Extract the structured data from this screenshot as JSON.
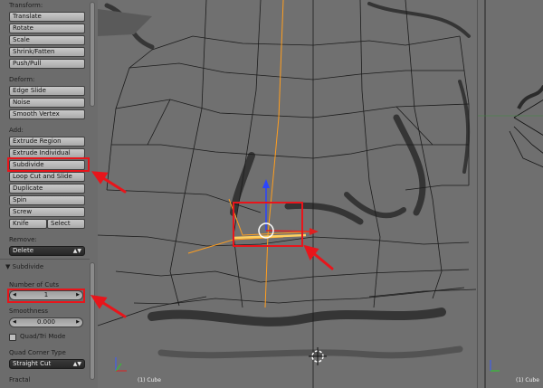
{
  "toolshelf": {
    "transform_title": "Transform:",
    "transform_buttons": [
      "Translate",
      "Rotate",
      "Scale",
      "Shrink/Fatten",
      "Push/Pull"
    ],
    "deform_title": "Deform:",
    "deform_buttons": [
      "Edge Slide",
      "Noise",
      "Smooth Vertex"
    ],
    "add_title": "Add:",
    "add_buttons": [
      "Extrude Region",
      "Extrude Individual",
      "Subdivide",
      "Loop Cut and Slide",
      "Duplicate",
      "Spin",
      "Screw"
    ],
    "knife_label": "Knife",
    "select_label": "Select",
    "remove_title": "Remove:",
    "remove_value": "Delete"
  },
  "operator": {
    "title": "Subdivide",
    "cuts_label": "Number of Cuts",
    "cuts_value": "1",
    "smooth_label": "Smoothness",
    "smooth_value": "0.000",
    "quadtri_label": "Quad/Tri Mode",
    "quadtri_checked": false,
    "corner_label": "Quad Corner Type",
    "corner_value": "Straight Cut",
    "fractal_label": "Fractal"
  },
  "viewport": {
    "object_label": "(1) Cube"
  },
  "viewport_right": {
    "object_label": "(1) Cube"
  },
  "colors": {
    "highlight": "#e8151b",
    "selection": "#ff9e1f",
    "wire": "#1c1c1c"
  }
}
